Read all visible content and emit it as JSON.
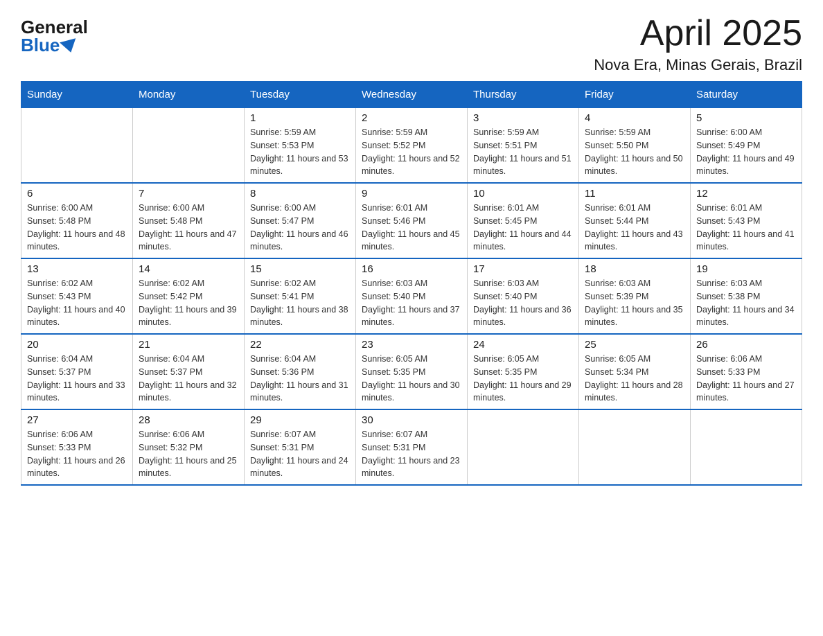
{
  "header": {
    "logo_general": "General",
    "logo_blue": "Blue",
    "title": "April 2025",
    "subtitle": "Nova Era, Minas Gerais, Brazil"
  },
  "weekdays": [
    "Sunday",
    "Monday",
    "Tuesday",
    "Wednesday",
    "Thursday",
    "Friday",
    "Saturday"
  ],
  "weeks": [
    [
      {
        "day": "",
        "sunrise": "",
        "sunset": "",
        "daylight": ""
      },
      {
        "day": "",
        "sunrise": "",
        "sunset": "",
        "daylight": ""
      },
      {
        "day": "1",
        "sunrise": "Sunrise: 5:59 AM",
        "sunset": "Sunset: 5:53 PM",
        "daylight": "Daylight: 11 hours and 53 minutes."
      },
      {
        "day": "2",
        "sunrise": "Sunrise: 5:59 AM",
        "sunset": "Sunset: 5:52 PM",
        "daylight": "Daylight: 11 hours and 52 minutes."
      },
      {
        "day": "3",
        "sunrise": "Sunrise: 5:59 AM",
        "sunset": "Sunset: 5:51 PM",
        "daylight": "Daylight: 11 hours and 51 minutes."
      },
      {
        "day": "4",
        "sunrise": "Sunrise: 5:59 AM",
        "sunset": "Sunset: 5:50 PM",
        "daylight": "Daylight: 11 hours and 50 minutes."
      },
      {
        "day": "5",
        "sunrise": "Sunrise: 6:00 AM",
        "sunset": "Sunset: 5:49 PM",
        "daylight": "Daylight: 11 hours and 49 minutes."
      }
    ],
    [
      {
        "day": "6",
        "sunrise": "Sunrise: 6:00 AM",
        "sunset": "Sunset: 5:48 PM",
        "daylight": "Daylight: 11 hours and 48 minutes."
      },
      {
        "day": "7",
        "sunrise": "Sunrise: 6:00 AM",
        "sunset": "Sunset: 5:48 PM",
        "daylight": "Daylight: 11 hours and 47 minutes."
      },
      {
        "day": "8",
        "sunrise": "Sunrise: 6:00 AM",
        "sunset": "Sunset: 5:47 PM",
        "daylight": "Daylight: 11 hours and 46 minutes."
      },
      {
        "day": "9",
        "sunrise": "Sunrise: 6:01 AM",
        "sunset": "Sunset: 5:46 PM",
        "daylight": "Daylight: 11 hours and 45 minutes."
      },
      {
        "day": "10",
        "sunrise": "Sunrise: 6:01 AM",
        "sunset": "Sunset: 5:45 PM",
        "daylight": "Daylight: 11 hours and 44 minutes."
      },
      {
        "day": "11",
        "sunrise": "Sunrise: 6:01 AM",
        "sunset": "Sunset: 5:44 PM",
        "daylight": "Daylight: 11 hours and 43 minutes."
      },
      {
        "day": "12",
        "sunrise": "Sunrise: 6:01 AM",
        "sunset": "Sunset: 5:43 PM",
        "daylight": "Daylight: 11 hours and 41 minutes."
      }
    ],
    [
      {
        "day": "13",
        "sunrise": "Sunrise: 6:02 AM",
        "sunset": "Sunset: 5:43 PM",
        "daylight": "Daylight: 11 hours and 40 minutes."
      },
      {
        "day": "14",
        "sunrise": "Sunrise: 6:02 AM",
        "sunset": "Sunset: 5:42 PM",
        "daylight": "Daylight: 11 hours and 39 minutes."
      },
      {
        "day": "15",
        "sunrise": "Sunrise: 6:02 AM",
        "sunset": "Sunset: 5:41 PM",
        "daylight": "Daylight: 11 hours and 38 minutes."
      },
      {
        "day": "16",
        "sunrise": "Sunrise: 6:03 AM",
        "sunset": "Sunset: 5:40 PM",
        "daylight": "Daylight: 11 hours and 37 minutes."
      },
      {
        "day": "17",
        "sunrise": "Sunrise: 6:03 AM",
        "sunset": "Sunset: 5:40 PM",
        "daylight": "Daylight: 11 hours and 36 minutes."
      },
      {
        "day": "18",
        "sunrise": "Sunrise: 6:03 AM",
        "sunset": "Sunset: 5:39 PM",
        "daylight": "Daylight: 11 hours and 35 minutes."
      },
      {
        "day": "19",
        "sunrise": "Sunrise: 6:03 AM",
        "sunset": "Sunset: 5:38 PM",
        "daylight": "Daylight: 11 hours and 34 minutes."
      }
    ],
    [
      {
        "day": "20",
        "sunrise": "Sunrise: 6:04 AM",
        "sunset": "Sunset: 5:37 PM",
        "daylight": "Daylight: 11 hours and 33 minutes."
      },
      {
        "day": "21",
        "sunrise": "Sunrise: 6:04 AM",
        "sunset": "Sunset: 5:37 PM",
        "daylight": "Daylight: 11 hours and 32 minutes."
      },
      {
        "day": "22",
        "sunrise": "Sunrise: 6:04 AM",
        "sunset": "Sunset: 5:36 PM",
        "daylight": "Daylight: 11 hours and 31 minutes."
      },
      {
        "day": "23",
        "sunrise": "Sunrise: 6:05 AM",
        "sunset": "Sunset: 5:35 PM",
        "daylight": "Daylight: 11 hours and 30 minutes."
      },
      {
        "day": "24",
        "sunrise": "Sunrise: 6:05 AM",
        "sunset": "Sunset: 5:35 PM",
        "daylight": "Daylight: 11 hours and 29 minutes."
      },
      {
        "day": "25",
        "sunrise": "Sunrise: 6:05 AM",
        "sunset": "Sunset: 5:34 PM",
        "daylight": "Daylight: 11 hours and 28 minutes."
      },
      {
        "day": "26",
        "sunrise": "Sunrise: 6:06 AM",
        "sunset": "Sunset: 5:33 PM",
        "daylight": "Daylight: 11 hours and 27 minutes."
      }
    ],
    [
      {
        "day": "27",
        "sunrise": "Sunrise: 6:06 AM",
        "sunset": "Sunset: 5:33 PM",
        "daylight": "Daylight: 11 hours and 26 minutes."
      },
      {
        "day": "28",
        "sunrise": "Sunrise: 6:06 AM",
        "sunset": "Sunset: 5:32 PM",
        "daylight": "Daylight: 11 hours and 25 minutes."
      },
      {
        "day": "29",
        "sunrise": "Sunrise: 6:07 AM",
        "sunset": "Sunset: 5:31 PM",
        "daylight": "Daylight: 11 hours and 24 minutes."
      },
      {
        "day": "30",
        "sunrise": "Sunrise: 6:07 AM",
        "sunset": "Sunset: 5:31 PM",
        "daylight": "Daylight: 11 hours and 23 minutes."
      },
      {
        "day": "",
        "sunrise": "",
        "sunset": "",
        "daylight": ""
      },
      {
        "day": "",
        "sunrise": "",
        "sunset": "",
        "daylight": ""
      },
      {
        "day": "",
        "sunrise": "",
        "sunset": "",
        "daylight": ""
      }
    ]
  ]
}
